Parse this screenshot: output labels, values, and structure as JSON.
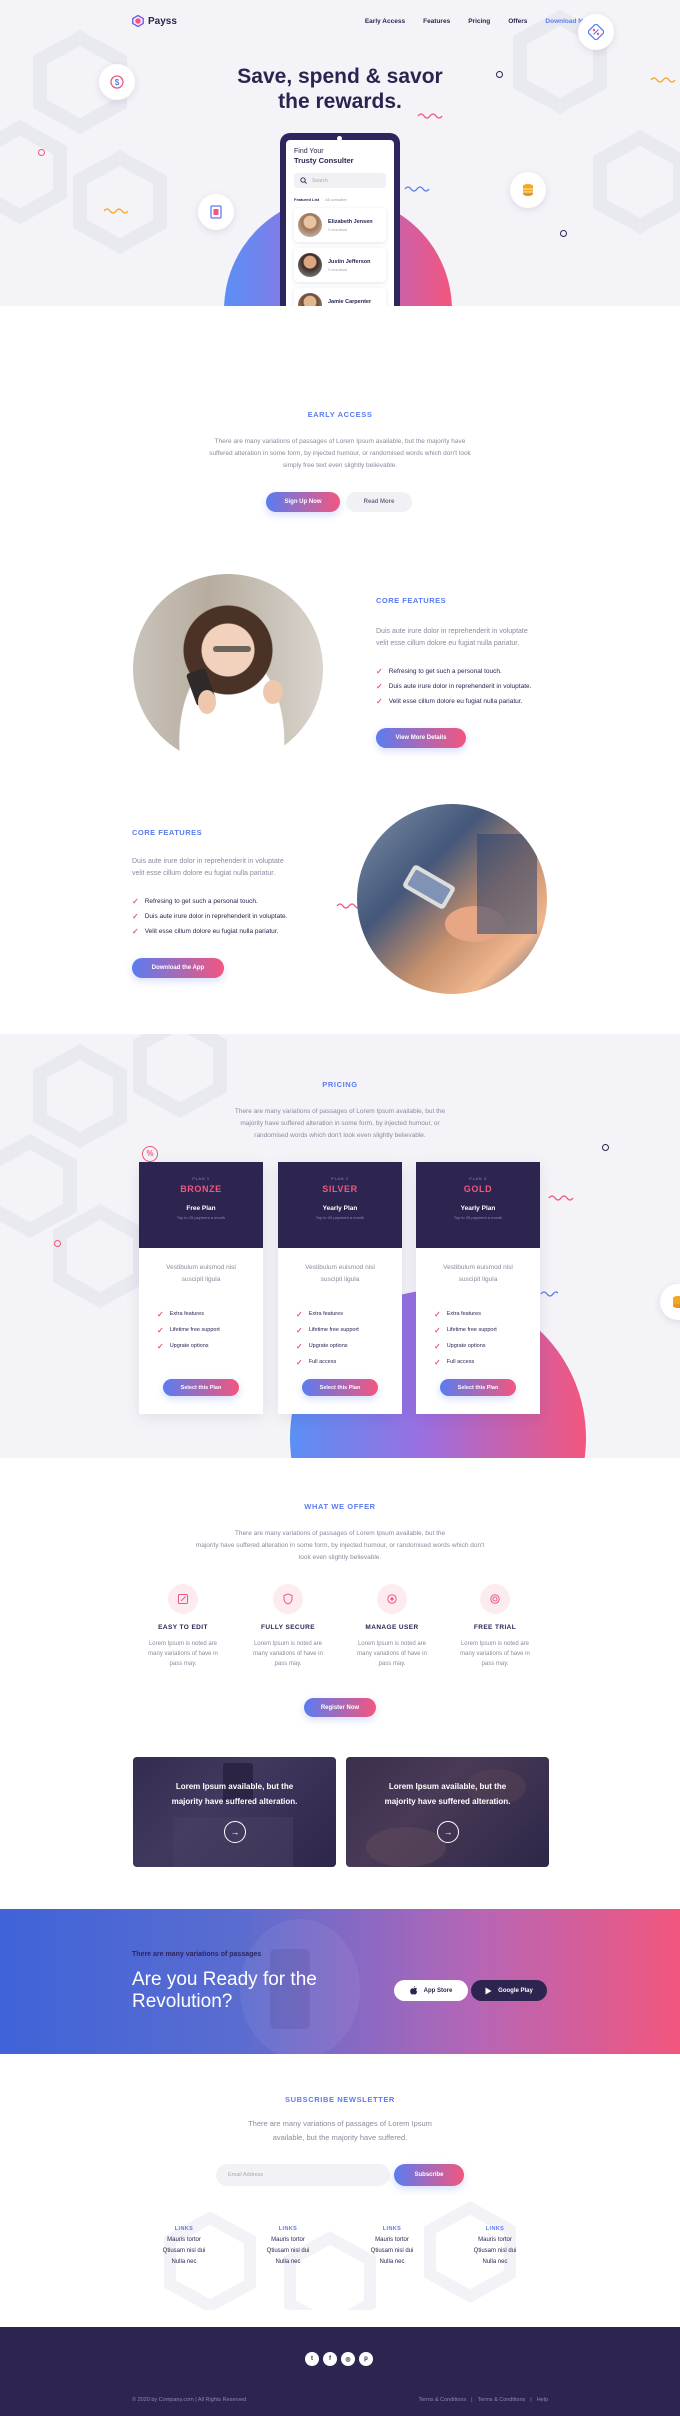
{
  "nav": {
    "logo": "Payss",
    "links": [
      "Early Access",
      "Features",
      "Pricing",
      "Offers"
    ],
    "download": "Download Now"
  },
  "hero": {
    "title_line1": "Save, spend & savor",
    "title_line2": "the rewards.",
    "phone": {
      "title_line1": "Find Your",
      "title_line2": "Trusty Consulter",
      "search_placeholder": "Search",
      "filter_active": "Featured List",
      "filter_other": "All consulter",
      "consultants": [
        {
          "name": "Elizabeth Jensen",
          "role": "Consultant"
        },
        {
          "name": "Justin Jefferson",
          "role": "Consultant"
        },
        {
          "name": "Jamie Carpenter",
          "role": "Consultant"
        }
      ]
    }
  },
  "early": {
    "label": "EARLY ACCESS",
    "text_line1": "There are many variations of passages of Lorem Ipsum available, but the majority have",
    "text_line2": "suffered alteration in some form, by injected humour, or randomised words which don't look",
    "text_line3": "simply free text even slightly believable.",
    "signup": "Sign Up Now",
    "readmore": "Read More"
  },
  "feature1": {
    "label": "CORE FEATURES",
    "desc_line1": "Duis aute irure dolor in reprehenderit in voluptate",
    "desc_line2": "velit esse cillum dolore eu fugiat nulla pariatur.",
    "checks": [
      "Refresing to get such a personal touch.",
      "Duis aute irure dolor in reprehenderit in voluptate.",
      "Velit esse cillum dolore eu fugiat nulla pariatur."
    ],
    "button": "View More Details"
  },
  "feature2": {
    "label": "CORE FEATURES",
    "desc_line1": "Duis aute irure dolor in reprehenderit in voluptate",
    "desc_line2": "velit esse cillum dolore eu fugiat nulla pariatur.",
    "checks": [
      "Refresing to get such a personal touch.",
      "Duis aute irure dolor in reprehenderit in voluptate.",
      "Velit esse cillum dolore eu fugiat nulla pariatur."
    ],
    "button": "Download the App"
  },
  "pricing": {
    "label": "PRICING",
    "text_line1": "There are many variations of passages of Lorem Ipsum available, but the",
    "text_line2": "majority have suffered alteration in some form, by injected humour, or",
    "text_line3": "randomised words which don't look even slightly believable.",
    "plans": [
      {
        "tag": "PLAN 1",
        "name": "BRONZE",
        "plan": "Free Plan",
        "note": "Top to 25 payment a month",
        "desc_line1": "Vestibulum euismod nisl",
        "desc_line2": "suscipit ligula",
        "features": [
          "Extra features",
          "Lifetime free support",
          "Upgrate options"
        ],
        "button": "Select this Plan"
      },
      {
        "tag": "PLAN 2",
        "name": "SILVER",
        "plan": "Yearly Plan",
        "note": "Top to 25 payment a month",
        "desc_line1": "Vestibulum euismod nisl",
        "desc_line2": "suscipit ligula",
        "features": [
          "Extra features",
          "Lifetime free support",
          "Upgrate options",
          "Full access"
        ],
        "button": "Select this Plan"
      },
      {
        "tag": "PLAN 3",
        "name": "GOLD",
        "plan": "Yearly Plan",
        "note": "Top to 25 payment a month",
        "desc_line1": "Vestibulum euismod nisl",
        "desc_line2": "suscipit ligula",
        "features": [
          "Extra features",
          "Lifetime free support",
          "Upgrate options",
          "Full access"
        ],
        "button": "Select this Plan"
      }
    ]
  },
  "offer": {
    "label": "WHAT WE OFFER",
    "text_line1": "There are many variations of passages of Lorem Ipsum available, but the",
    "text_line2": "majority have suffered alteration in some form, by injected humour, or randomised words which don't",
    "text_line3": "look even slightly believable.",
    "items": [
      {
        "title": "EASY TO EDIT",
        "d1": "Lorem Ipsum is noted are",
        "d2": "many variations of have in",
        "d3": "pass may."
      },
      {
        "title": "FULLY SECURE",
        "d1": "Lorem Ipsum is noted are",
        "d2": "many variations of have in",
        "d3": "pass may."
      },
      {
        "title": "MANAGE USER",
        "d1": "Lorem Ipsum is noted are",
        "d2": "many variations of have in",
        "d3": "pass may."
      },
      {
        "title": "FREE TRIAL",
        "d1": "Lorem Ipsum is noted are",
        "d2": "many variations of have in",
        "d3": "pass may."
      }
    ],
    "button": "Register Now"
  },
  "cards": [
    {
      "line1": "Lorem Ipsum available, but the",
      "line2": "majority have suffered alteration."
    },
    {
      "line1": "Lorem Ipsum available, but the",
      "line2": "majority have suffered alteration."
    }
  ],
  "banner": {
    "small": "There are many variations of passages",
    "big_line1": "Are you Ready for the",
    "big_line2": "Revolution?",
    "appstore": "App Store",
    "googleplay": "Google Play"
  },
  "newsletter": {
    "label": "SUBSCRIBE NEWSLETTER",
    "text_line1": "There are many variations of passages of Lorem Ipsum",
    "text_line2": "available, but the majority have suffered.",
    "placeholder": "Email Address",
    "button": "Subscribe"
  },
  "links": [
    {
      "head": "LINKS",
      "items": [
        "Mauris tortor",
        "Qtiusam nisl dui",
        "Nulla nec"
      ]
    },
    {
      "head": "LINKS",
      "items": [
        "Mauris tortor",
        "Qtiusam nisl dui",
        "Nulla nec"
      ]
    },
    {
      "head": "LINKS",
      "items": [
        "Mauris tortor",
        "Qtiusam nisl dui",
        "Nulla nec"
      ]
    },
    {
      "head": "LINKS",
      "items": [
        "Mauris tortor",
        "Qtiusam nisl dui",
        "Nulla nec"
      ]
    }
  ],
  "footer": {
    "copyright": "© 2020 by Company.com | All Rights Reserved",
    "terms": "Terms & Conditions",
    "terms2": "Terms & Conditions",
    "help": "Help",
    "social": [
      "twitter-icon",
      "facebook-icon",
      "instagram-icon",
      "pinterest-icon"
    ]
  },
  "colors": {
    "navy": "#2d2550",
    "blue": "#5b7cf0",
    "pink": "#f2567e",
    "gold": "#f5a623"
  }
}
